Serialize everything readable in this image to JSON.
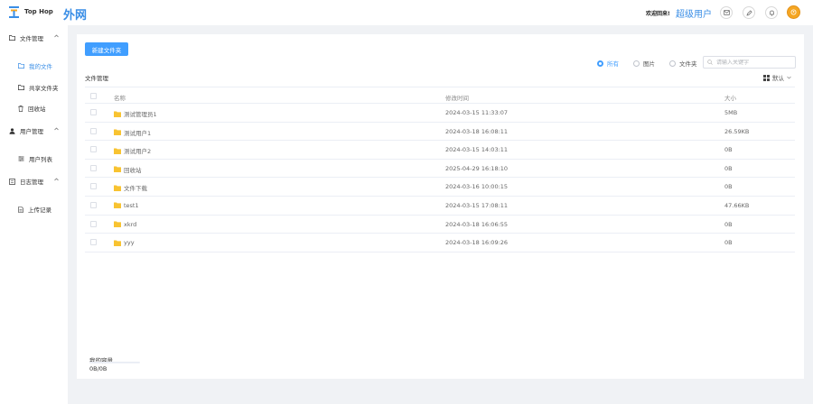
{
  "header": {
    "brand": "Top Hop",
    "app_name": "外网",
    "welcome": "欢迎回来!",
    "username": "超级用户"
  },
  "sidebar": {
    "groups": [
      {
        "label": "文件管理",
        "icon": "folder-icon",
        "items": [
          {
            "label": "我的文件",
            "icon": "folder-open-icon",
            "active": true
          },
          {
            "label": "共享文件夹",
            "icon": "folder-share-icon"
          },
          {
            "label": "回收站",
            "icon": "trash-icon"
          }
        ]
      },
      {
        "label": "用户管理",
        "icon": "user-icon",
        "items": [
          {
            "label": "用户列表",
            "icon": "list-icon"
          }
        ]
      },
      {
        "label": "日志管理",
        "icon": "log-icon",
        "items": [
          {
            "label": "上传记录",
            "icon": "upload-record-icon"
          }
        ]
      }
    ]
  },
  "toolbar": {
    "new_folder": "新建文件夹",
    "filters": [
      "所有",
      "图片",
      "文件夹"
    ],
    "selected_filter": "所有",
    "search_placeholder": "请输入关键字",
    "breadcrumb": "文件管理",
    "sort_label": "默认"
  },
  "table": {
    "columns": [
      "名称",
      "修改时间",
      "大小"
    ],
    "rows": [
      {
        "name": "测试管理员1",
        "time": "2024-03-15 11:33:07",
        "size": "5MB"
      },
      {
        "name": "测试用户1",
        "time": "2024-03-18 16:08:11",
        "size": "26.59KB"
      },
      {
        "name": "测试用户2",
        "time": "2024-03-15 14:03:11",
        "size": "0B"
      },
      {
        "name": "回收站",
        "time": "2025-04-29 16:18:10",
        "size": "0B"
      },
      {
        "name": "文件下载",
        "time": "2024-03-16 10:00:15",
        "size": "0B"
      },
      {
        "name": "test1",
        "time": "2024-03-15 17:08:11",
        "size": "47.66KB"
      },
      {
        "name": "xkrd",
        "time": "2024-03-18 16:06:55",
        "size": "0B"
      },
      {
        "name": "yyy",
        "time": "2024-03-18 16:09:26",
        "size": "0B"
      }
    ]
  },
  "storage": {
    "label": "我的容量",
    "value": "0B/0B",
    "used_fraction": 0
  },
  "colors": {
    "accent": "#409eff",
    "brand_blue": "#3a8ee6",
    "folder": "#f8c331",
    "avatar": "#f5a623"
  }
}
